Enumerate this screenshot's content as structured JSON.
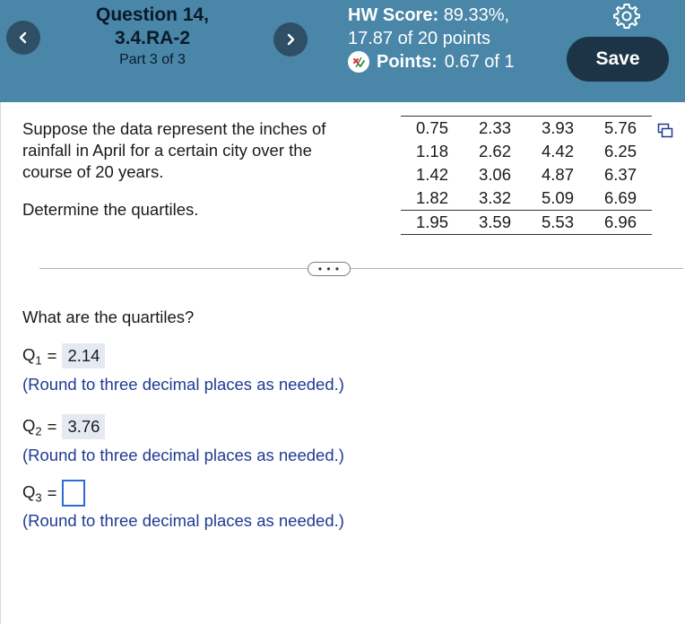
{
  "header": {
    "question_title_line1": "Question 14,",
    "question_title_line2": "3.4.RA-2",
    "part": "Part 3 of 3",
    "hw_score_label": "HW Score:",
    "hw_score_value": "89.33%,",
    "hw_points": "17.87 of 20 points",
    "points_label": "Points:",
    "points_value": "0.67 of 1",
    "save_label": "Save",
    "prev_icon": "chevron-left-icon",
    "next_icon": "chevron-right-icon",
    "settings_icon": "gear-icon",
    "partial_icon": "partial-credit-icon"
  },
  "problem": {
    "text": "Suppose the data represent the inches of rainfall in April for a certain city over the course of 20 years.",
    "instruction": "Determine the quartiles."
  },
  "data_table": {
    "rows": [
      [
        "0.75",
        "2.33",
        "3.93",
        "5.76"
      ],
      [
        "1.18",
        "2.62",
        "4.42",
        "6.25"
      ],
      [
        "1.42",
        "3.06",
        "4.87",
        "6.37"
      ],
      [
        "1.82",
        "3.32",
        "5.09",
        "6.69"
      ],
      [
        "1.95",
        "3.59",
        "5.53",
        "6.96"
      ]
    ],
    "copy_icon": "copy-icon"
  },
  "more_label": "• • •",
  "answers": {
    "question": "What are the quartiles?",
    "q1_label": "Q",
    "q1_sub": "1",
    "q1_value": "2.14",
    "q2_label": "Q",
    "q2_sub": "2",
    "q2_value": "3.76",
    "q3_label": "Q",
    "q3_sub": "3",
    "q3_value": "",
    "equals": "=",
    "hint": "(Round to three decimal places as needed.)"
  },
  "colors": {
    "header_bg": "#4a86a8",
    "save_bg": "#1d3446",
    "hint_text": "#1f3a93",
    "input_border": "#2e6bd6",
    "answer_bg": "#e5e9f2"
  }
}
